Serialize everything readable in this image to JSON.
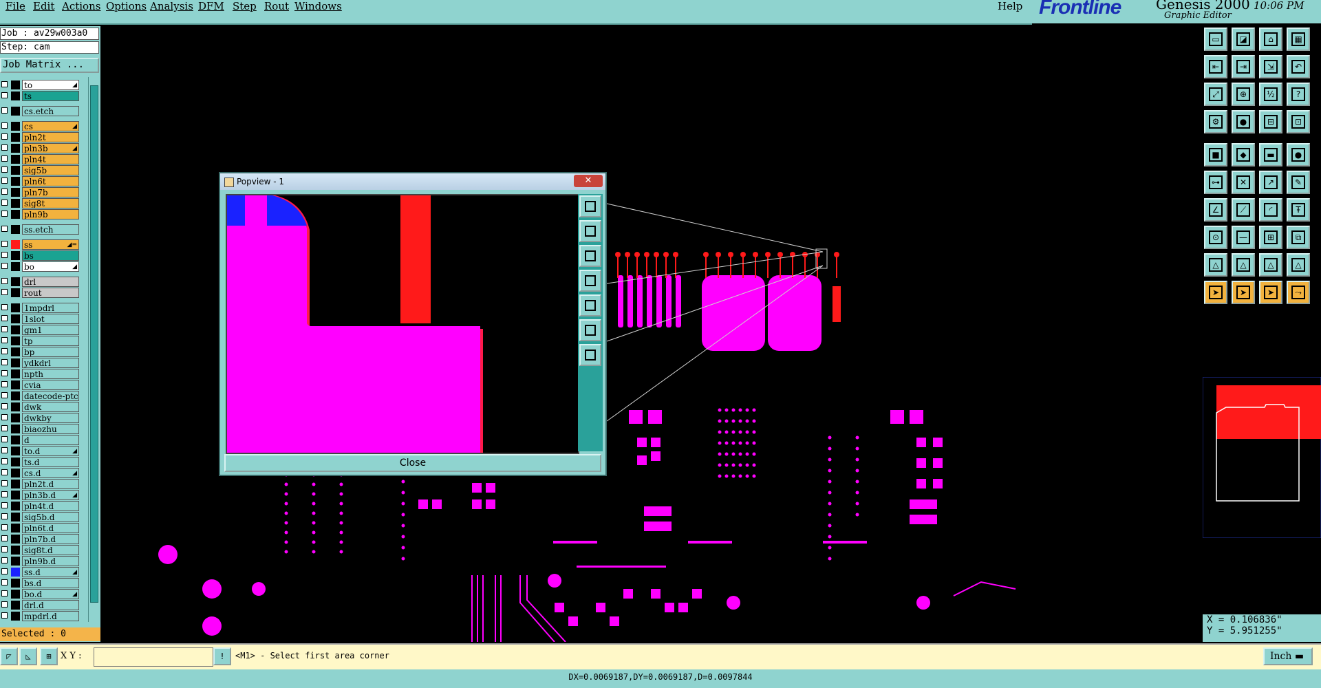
{
  "menu": [
    {
      "label": "File"
    },
    {
      "label": "Edit"
    },
    {
      "label": "Actions"
    },
    {
      "label": "Options"
    },
    {
      "label": "Analysis"
    },
    {
      "label": "DFM"
    },
    {
      "label": "Step"
    },
    {
      "label": "Rout"
    },
    {
      "label": "Windows"
    },
    {
      "label": "Help"
    }
  ],
  "brand": {
    "name": "Frontline",
    "product": "Genesis 2000",
    "subtitle": "Graphic Editor",
    "clock": "10:06 PM"
  },
  "job": {
    "job_label": "Job : av29w003a0",
    "step_label": "Step: cam",
    "matrix_button": "Job Matrix ..."
  },
  "layers": [
    {
      "name": "to",
      "bg": "#ffffff",
      "sw": "#000000",
      "arrow": "◢"
    },
    {
      "name": "ts",
      "bg": "#1aa392",
      "sw": "#000000",
      "arrow": ""
    },
    {
      "gap": true
    },
    {
      "name": "cs.etch",
      "bg": "#8fd3cf",
      "sw": "#000000",
      "arrow": ""
    },
    {
      "gap": true
    },
    {
      "name": "cs",
      "bg": "#f2b23e",
      "sw": "#000000",
      "arrow": "◢"
    },
    {
      "name": "pln2t",
      "bg": "#f2b23e",
      "sw": "#000000",
      "arrow": ""
    },
    {
      "name": "pln3b",
      "bg": "#f2b23e",
      "sw": "#000000",
      "arrow": "◢"
    },
    {
      "name": "pln4t",
      "bg": "#f2b23e",
      "sw": "#000000",
      "arrow": ""
    },
    {
      "name": "sig5b",
      "bg": "#f2b23e",
      "sw": "#000000",
      "arrow": ""
    },
    {
      "name": "pln6t",
      "bg": "#f2b23e",
      "sw": "#000000",
      "arrow": ""
    },
    {
      "name": "pln7b",
      "bg": "#f2b23e",
      "sw": "#000000",
      "arrow": ""
    },
    {
      "name": "sig8t",
      "bg": "#f2b23e",
      "sw": "#000000",
      "arrow": ""
    },
    {
      "name": "pln9b",
      "bg": "#f2b23e",
      "sw": "#000000",
      "arrow": ""
    },
    {
      "gap": true
    },
    {
      "name": "ss.etch",
      "bg": "#8fd3cf",
      "sw": "#000000",
      "arrow": ""
    },
    {
      "gap": true
    },
    {
      "name": "ss",
      "bg": "#f2b23e",
      "sw": "#ff1a1a",
      "arrow": "◢="
    },
    {
      "name": "bs",
      "bg": "#1aa392",
      "sw": "#000000",
      "arrow": ""
    },
    {
      "name": "bo",
      "bg": "#ffffff",
      "sw": "#000000",
      "arrow": "◢"
    },
    {
      "gap": true
    },
    {
      "name": "drl",
      "bg": "#c8c8c8",
      "sw": "#000000",
      "arrow": ""
    },
    {
      "name": "rout",
      "bg": "#c8c8c8",
      "sw": "#000000",
      "arrow": ""
    },
    {
      "gap": true
    },
    {
      "name": "1mpdrl",
      "bg": "#8fd3cf",
      "sw": "#000000",
      "arrow": ""
    },
    {
      "name": "1slot",
      "bg": "#8fd3cf",
      "sw": "#000000",
      "arrow": ""
    },
    {
      "name": "gm1",
      "bg": "#8fd3cf",
      "sw": "#000000",
      "arrow": ""
    },
    {
      "name": "tp",
      "bg": "#8fd3cf",
      "sw": "#000000",
      "arrow": ""
    },
    {
      "name": "bp",
      "bg": "#8fd3cf",
      "sw": "#000000",
      "arrow": ""
    },
    {
      "name": "ydkdrl",
      "bg": "#8fd3cf",
      "sw": "#000000",
      "arrow": ""
    },
    {
      "name": "npth",
      "bg": "#8fd3cf",
      "sw": "#000000",
      "arrow": ""
    },
    {
      "name": "cvia",
      "bg": "#8fd3cf",
      "sw": "#000000",
      "arrow": ""
    },
    {
      "name": "datecode-ptc",
      "bg": "#8fd3cf",
      "sw": "#000000",
      "arrow": ""
    },
    {
      "name": "dwk",
      "bg": "#8fd3cf",
      "sw": "#000000",
      "arrow": ""
    },
    {
      "name": "dwkby",
      "bg": "#8fd3cf",
      "sw": "#000000",
      "arrow": ""
    },
    {
      "name": "biaozhu",
      "bg": "#8fd3cf",
      "sw": "#000000",
      "arrow": ""
    },
    {
      "name": "d",
      "bg": "#8fd3cf",
      "sw": "#000000",
      "arrow": ""
    },
    {
      "name": "to.d",
      "bg": "#8fd3cf",
      "sw": "#000000",
      "arrow": "◢"
    },
    {
      "name": "ts.d",
      "bg": "#8fd3cf",
      "sw": "#000000",
      "arrow": ""
    },
    {
      "name": "cs.d",
      "bg": "#8fd3cf",
      "sw": "#000000",
      "arrow": "◢"
    },
    {
      "name": "pln2t.d",
      "bg": "#8fd3cf",
      "sw": "#000000",
      "arrow": ""
    },
    {
      "name": "pln3b.d",
      "bg": "#8fd3cf",
      "sw": "#000000",
      "arrow": "◢"
    },
    {
      "name": "pln4t.d",
      "bg": "#8fd3cf",
      "sw": "#000000",
      "arrow": ""
    },
    {
      "name": "sig5b.d",
      "bg": "#8fd3cf",
      "sw": "#000000",
      "arrow": ""
    },
    {
      "name": "pln6t.d",
      "bg": "#8fd3cf",
      "sw": "#000000",
      "arrow": ""
    },
    {
      "name": "pln7b.d",
      "bg": "#8fd3cf",
      "sw": "#000000",
      "arrow": ""
    },
    {
      "name": "sig8t.d",
      "bg": "#8fd3cf",
      "sw": "#000000",
      "arrow": ""
    },
    {
      "name": "pln9b.d",
      "bg": "#8fd3cf",
      "sw": "#000000",
      "arrow": ""
    },
    {
      "name": "ss.d",
      "bg": "#8fd3cf",
      "sw": "#1a22ff",
      "arrow": "◢"
    },
    {
      "name": "bs.d",
      "bg": "#8fd3cf",
      "sw": "#000000",
      "arrow": ""
    },
    {
      "name": "bo.d",
      "bg": "#8fd3cf",
      "sw": "#000000",
      "arrow": "◢"
    },
    {
      "name": "drl.d",
      "bg": "#8fd3cf",
      "sw": "#000000",
      "arrow": ""
    },
    {
      "name": "mpdrl.d",
      "bg": "#8fd3cf",
      "sw": "#000000",
      "arrow": ""
    }
  ],
  "selected_label": "Selected : 0",
  "popview": {
    "title": "Popview - 1",
    "close_label": "Close",
    "close_x": "✕"
  },
  "coords": {
    "x": "X = 0.106836\"",
    "y": "Y = 5.951255\""
  },
  "bottom": {
    "xy_label": "X Y :",
    "xy_value": "",
    "prompt": "<M1> - Select first area corner",
    "unit": "Inch"
  },
  "status": "DX=0.0069187,DY=0.0069187,D=0.0097844",
  "colors": {
    "panel": "#8fd3cf",
    "pad": "#ff00ff",
    "accent_red": "#ff1a1a",
    "accent_blue": "#1a22ff"
  },
  "toolbar_icons": [
    "layer-icon",
    "save-icon",
    "house-icon",
    "grid-icon",
    "arrow-left-icon",
    "arrow-right-icon",
    "step-icon",
    "undo-icon",
    "fit-icon",
    "zoom-icon",
    "scale-icon",
    "help-icon",
    "tool-icon",
    "probe-icon",
    "net-icon",
    "measure-icon",
    "select-icon",
    "color-icon",
    "ruler-icon",
    "pad-icon",
    "connect-icon",
    "cross-icon",
    "point-icon",
    "edit-icon",
    "line-icon",
    "angle-icon",
    "arc-icon",
    "text-icon",
    "snap-icon",
    "minus-icon",
    "feature-icon",
    "copy-icon",
    "triangle-icon",
    "triangle-2-icon",
    "triangle-3-icon",
    "triangle-4-icon",
    "pointer-icon",
    "pointer-2-icon",
    "pointer-3-icon",
    "route-icon"
  ]
}
